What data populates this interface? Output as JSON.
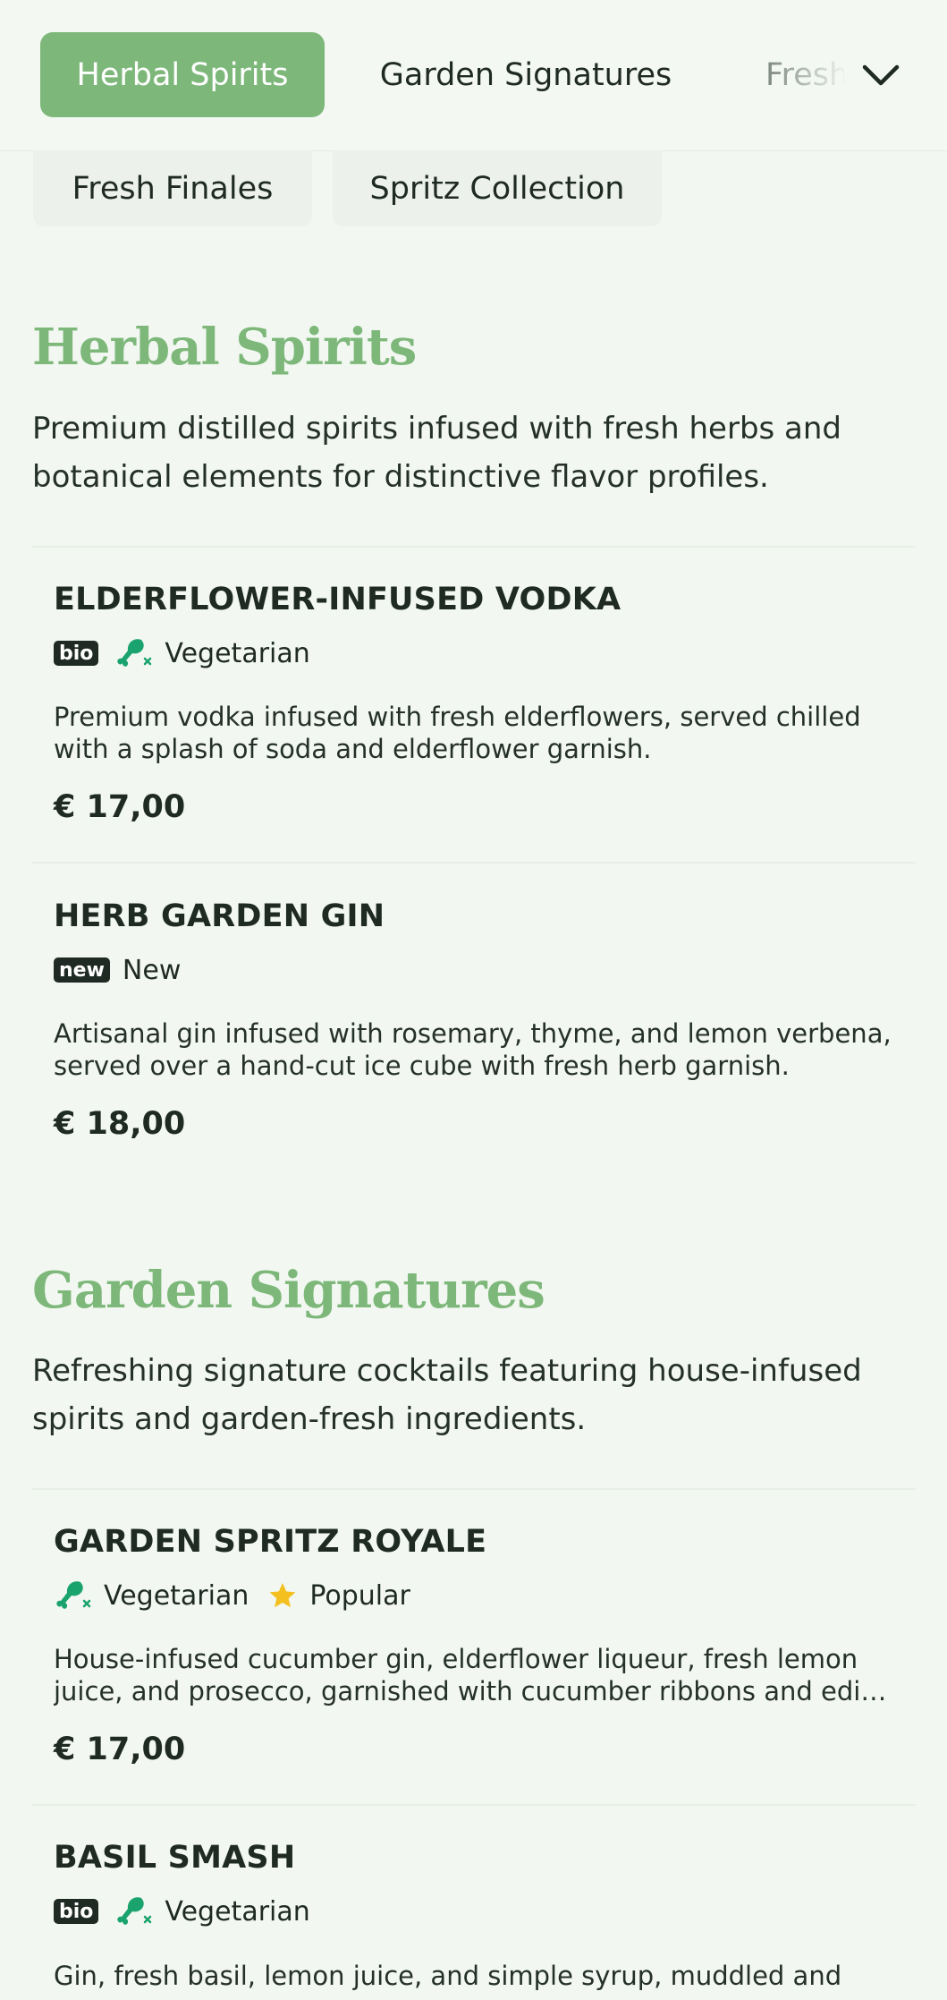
{
  "nav": {
    "tabs": [
      {
        "label": "Herbal Spirits",
        "active": true
      },
      {
        "label": "Garden Signatures",
        "active": false
      },
      {
        "label": "Fresh Finales",
        "active": false
      }
    ],
    "overflow_chips": [
      {
        "label": "Fresh Finales"
      },
      {
        "label": "Spritz Collection"
      }
    ],
    "expand_icon": "chevron-down-icon"
  },
  "colors": {
    "accent": "#7db87a",
    "badge_bg": "#1f2a24",
    "vegetarian_icon": "#1aa36c",
    "popular_star": "#f4c020",
    "background": "#f2f7f1"
  },
  "sections": [
    {
      "title": "Herbal Spirits",
      "description": "Premium distilled spirits infused with fresh herbs and botanical elements for distinctive flavor profiles.",
      "items": [
        {
          "name": "ELDERFLOWER-INFUSED VODKA",
          "tags": [
            {
              "type": "badge",
              "text": "bio"
            },
            {
              "type": "icon",
              "icon": "vegetarian-drumstick-icon",
              "label": "Vegetarian"
            }
          ],
          "description": "Premium vodka infused with fresh elderflowers, served chilled with a splash of soda and elderflower garnish.",
          "price": "€ 17,00"
        },
        {
          "name": "HERB GARDEN GIN",
          "tags": [
            {
              "type": "badge",
              "text": "new",
              "label": "New"
            }
          ],
          "description": "Artisanal gin infused with rosemary, thyme, and lemon verbena, served over a hand-cut ice cube with fresh herb garnish.",
          "price": "€ 18,00"
        }
      ]
    },
    {
      "title": "Garden Signatures",
      "description": "Refreshing signature cocktails featuring house-infused spirits and garden-fresh ingredients.",
      "items": [
        {
          "name": "GARDEN SPRITZ ROYALE",
          "tags": [
            {
              "type": "icon",
              "icon": "vegetarian-drumstick-icon",
              "label": "Vegetarian"
            },
            {
              "type": "icon",
              "icon": "star-icon",
              "label": "Popular"
            }
          ],
          "description_line1": "House-infused cucumber gin, elderflower liqueur, fresh lemon",
          "description_line2": "juice, and prosecco, garnished with cucumber ribbons and edibl…",
          "price": "€ 17,00"
        },
        {
          "name": "BASIL SMASH",
          "tags": [
            {
              "type": "badge",
              "text": "bio"
            },
            {
              "type": "icon",
              "icon": "vegetarian-drumstick-icon",
              "label": "Vegetarian"
            }
          ],
          "description": "Gin, fresh basil, lemon juice, and simple syrup, muddled and"
        }
      ]
    }
  ]
}
